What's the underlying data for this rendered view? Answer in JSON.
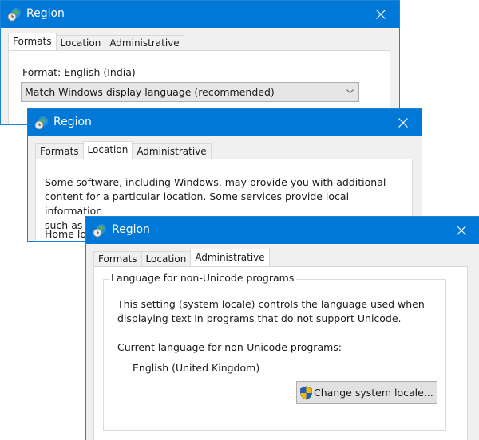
{
  "colors": {
    "titlebar": "#0078d7",
    "window_bg": "#f0f0f0",
    "panel_bg": "#ffffff"
  },
  "windows": [
    {
      "title": "Region",
      "icon": "region-globe-clock-icon",
      "close_icon": "close-icon",
      "tabs": [
        {
          "label": "Formats",
          "active": true
        },
        {
          "label": "Location",
          "active": false
        },
        {
          "label": "Administrative",
          "active": false
        }
      ],
      "format_label": "Format: English (India)",
      "format_dropdown": {
        "selected": "Match Windows display language (recommended)",
        "icon": "chevron-down-icon"
      }
    },
    {
      "title": "Region",
      "icon": "region-globe-clock-icon",
      "close_icon": "close-icon",
      "tabs": [
        {
          "label": "Formats",
          "active": false
        },
        {
          "label": "Location",
          "active": true
        },
        {
          "label": "Administrative",
          "active": false
        }
      ],
      "description_lines": [
        "Some software, including Windows, may provide you with additional",
        "content for a particular location. Some services provide local information",
        "such as news and weather."
      ],
      "home_location_label_partial": "Home lo"
    },
    {
      "title": "Region",
      "icon": "region-globe-clock-icon",
      "close_icon": "close-icon",
      "tabs": [
        {
          "label": "Formats",
          "active": false
        },
        {
          "label": "Location",
          "active": false
        },
        {
          "label": "Administrative",
          "active": true
        }
      ],
      "group_title": "Language for non-Unicode programs",
      "description_lines": [
        "This setting (system locale) controls the language used when",
        "displaying text in programs that do not support Unicode."
      ],
      "current_language_label": "Current language for non-Unicode programs:",
      "current_language_value": "English (United Kingdom)",
      "change_button": {
        "label": "Change system locale...",
        "icon": "uac-shield-icon"
      }
    }
  ]
}
